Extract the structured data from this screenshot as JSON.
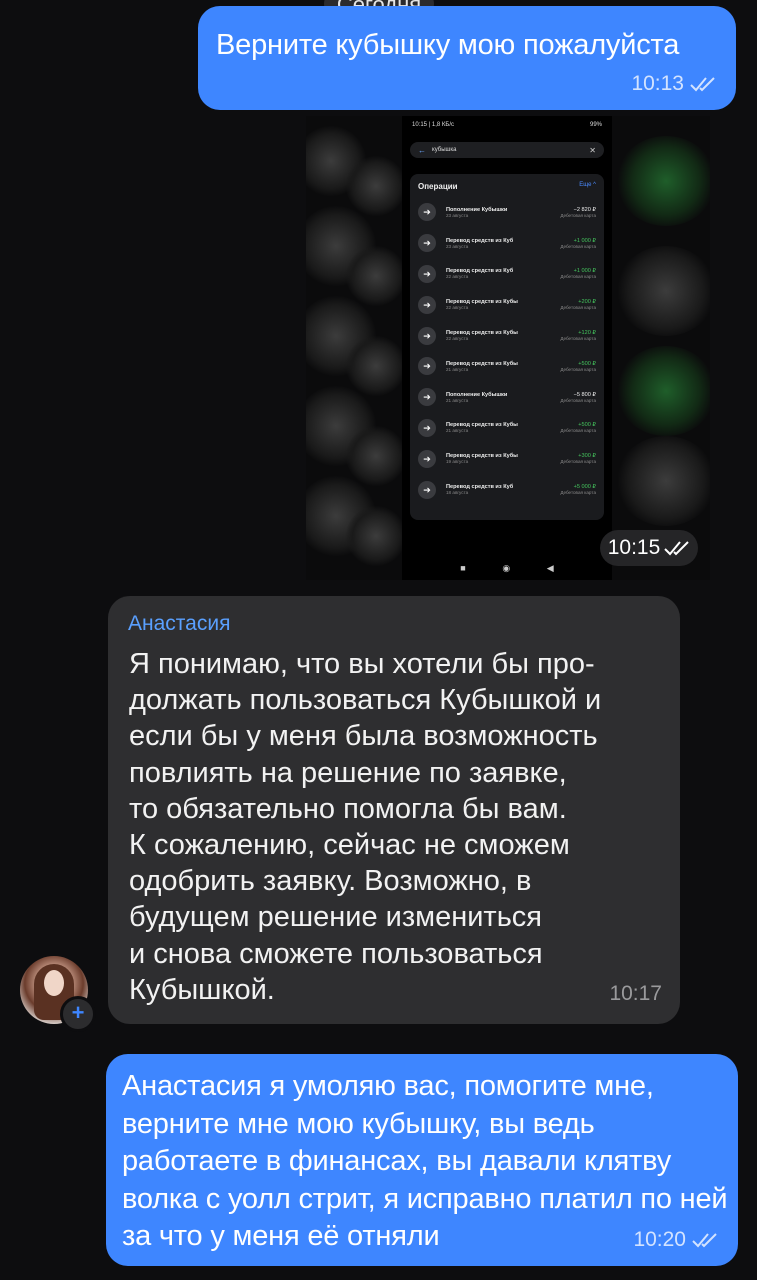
{
  "date_label": "Сегодня",
  "messages": [
    {
      "id": "m1",
      "direction": "outgoing",
      "text": "Верните кубышку мою пожалуйста",
      "time": "10:13",
      "status": "read"
    },
    {
      "id": "m2",
      "direction": "outgoing",
      "type": "image",
      "time": "10:15",
      "status": "read",
      "screenshot": {
        "status_bar": {
          "left": "10:15 | 1,8 КБ/с",
          "right": "99%"
        },
        "search_value": "кубышка",
        "section_title": "Операции",
        "more_label": "Еще ^",
        "operations": [
          {
            "title": "Пополнение Кубышки",
            "amount": "−2 820 ₽",
            "date": "23 августа",
            "card": "Дебетовая карта",
            "positive": false
          },
          {
            "title": "Перевод средств из Куб",
            "amount": "+1 000 ₽",
            "date": "23 августа",
            "card": "Дебетовая карта",
            "positive": true
          },
          {
            "title": "Перевод средств из Куб",
            "amount": "+1 000 ₽",
            "date": "22 августа",
            "card": "Дебетовая карта",
            "positive": true
          },
          {
            "title": "Перевод средств из Кубы",
            "amount": "+200 ₽",
            "date": "22 августа",
            "card": "Дебетовая карта",
            "positive": true
          },
          {
            "title": "Перевод средств из Кубы",
            "amount": "+120 ₽",
            "date": "22 августа",
            "card": "Дебетовая карта",
            "positive": true
          },
          {
            "title": "Перевод средств из Кубы",
            "amount": "+500 ₽",
            "date": "21 августа",
            "card": "Дебетовая карта",
            "positive": true
          },
          {
            "title": "Пополнение Кубышки",
            "amount": "−5 800 ₽",
            "date": "21 августа",
            "card": "Дебетовая карта",
            "positive": false
          },
          {
            "title": "Перевод средств из Кубы",
            "amount": "+500 ₽",
            "date": "21 августа",
            "card": "Дебетовая карта",
            "positive": true
          },
          {
            "title": "Перевод средств из Кубы",
            "amount": "+300 ₽",
            "date": "19 августа",
            "card": "Дебетовая карта",
            "positive": true
          },
          {
            "title": "Перевод средств из Куб",
            "amount": "+5 000 ₽",
            "date": "18 августа",
            "card": "Дебетовая карта",
            "positive": true
          }
        ]
      }
    },
    {
      "id": "m3",
      "direction": "incoming",
      "sender": "Анастасия",
      "lines": [
        "Я понимаю, что вы хотели бы про-",
        "должать пользоваться Кубышкой и",
        "если бы у меня была возможность",
        "повлиять на решение по заявке,",
        "то обязательно помогла бы вам.",
        "К сожалению, сейчас не сможем",
        "одобрить заявку. Возможно, в",
        "будущем решение измениться",
        "и снова сможете пользоваться",
        "Кубышкой."
      ],
      "time": "10:17"
    },
    {
      "id": "m4",
      "direction": "outgoing",
      "text": "Анастасия я умоляю вас, помогите мне, верните мне мою кубышку, вы ведь работаете в финансах, вы давали клятву волка с уолл стрит, я исправно платил по ней за что у меня её отняли",
      "time": "10:20",
      "status": "read"
    }
  ],
  "colors": {
    "background": "#0d0d0f",
    "outgoing_bubble": "#3e86ff",
    "incoming_bubble": "#2e2e30",
    "sender_name": "#5aa0ff",
    "positive_amount": "#44c45d"
  },
  "icons": {
    "read_receipt": "double-check-icon",
    "avatar_badge": "plus-icon"
  }
}
